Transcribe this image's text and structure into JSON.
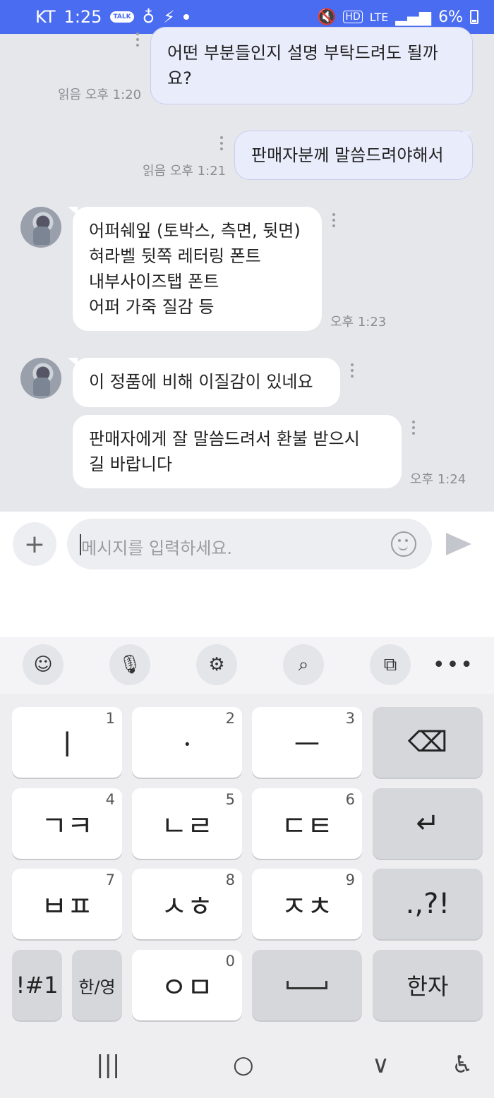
{
  "status": {
    "carrier": "KT",
    "time": "1:25",
    "talk_badge": "TALK",
    "hd": "HD",
    "lte": "LTE",
    "battery": "6%"
  },
  "messages": [
    {
      "sender": "me",
      "lines": [
        "어떤 부분들인지 설명 부탁드려도 될까",
        "요?"
      ],
      "meta": "읽음 오후 1:20"
    },
    {
      "sender": "me",
      "lines": [
        "판매자분께 말씀드려야해서"
      ],
      "meta": "읽음 오후 1:21"
    },
    {
      "sender": "other",
      "lines": [
        "어퍼쉐잎 (토박스, 측면, 뒷면)",
        "혀라벨 뒷쪽 레터링 폰트",
        "내부사이즈탭 폰트",
        "어퍼 가죽 질감 등"
      ],
      "meta": "오후 1:23"
    },
    {
      "sender": "other",
      "lines": [
        "이 정품에 비해 이질감이 있네요"
      ],
      "meta": ""
    },
    {
      "sender": "other",
      "lines": [
        "판매자에게 잘 말씀드려서 환불 받으시",
        "길 바랍니다"
      ],
      "meta": "오후 1:24"
    }
  ],
  "composer": {
    "plus": "+",
    "placeholder": "메시지를 입력하세요."
  },
  "toolbar": {
    "more": "•••"
  },
  "keys": [
    {
      "label": "ㅣ",
      "num": "1"
    },
    {
      "label": "ㆍ",
      "num": "2"
    },
    {
      "label": "ㅡ",
      "num": "3"
    },
    {
      "label": "⌫",
      "num": ""
    },
    {
      "label": "ㄱㅋ",
      "num": "4"
    },
    {
      "label": "ㄴㄹ",
      "num": "5"
    },
    {
      "label": "ㄷㅌ",
      "num": "6"
    },
    {
      "label": "↵",
      "num": ""
    },
    {
      "label": "ㅂㅍ",
      "num": "7"
    },
    {
      "label": "ㅅㅎ",
      "num": "8"
    },
    {
      "label": "ㅈㅊ",
      "num": "9"
    },
    {
      "label": ".,?!",
      "num": ""
    },
    {
      "label": "!#1",
      "num": ""
    },
    {
      "label": "한/영",
      "num": ""
    },
    {
      "label": "ㅇㅁ",
      "num": "0"
    },
    {
      "label": "",
      "num": ""
    },
    {
      "label": "한자",
      "num": ""
    }
  ],
  "nav": {
    "recent": "|||",
    "home": "○",
    "back": "∨",
    "accessibility": "♿"
  }
}
